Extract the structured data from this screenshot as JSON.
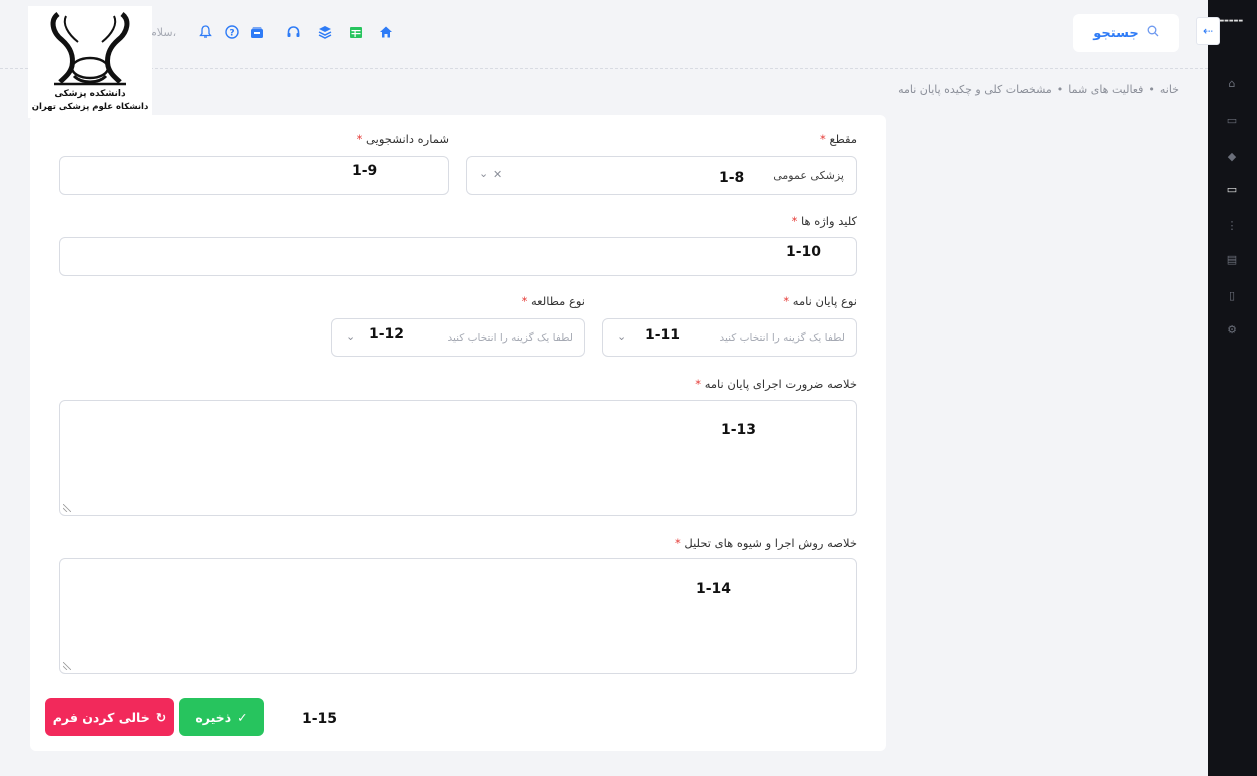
{
  "header": {
    "search_label": "جستجو",
    "greeting": "سلام،",
    "icons": [
      "bell-icon",
      "help-icon",
      "inbox-icon",
      "support-icon",
      "layers-icon",
      "table-icon",
      "home-icon"
    ]
  },
  "logo": {
    "line1": "دانشکده پزشکی",
    "line2": "دانشکاه علوم پزشکی تهران"
  },
  "breadcrumb": [
    "خانه",
    "فعالیت های شما",
    "مشخصات کلی و چکیده پایان نامه"
  ],
  "form": {
    "maqta": {
      "label": "مقطع",
      "value": "پزشکی عمومی",
      "annotation": "1-8"
    },
    "student_number": {
      "label": "شماره دانشجویی",
      "annotation": "1-9"
    },
    "keywords": {
      "label": "کلید واژه ها",
      "annotation": "1-10"
    },
    "thesis_type": {
      "label": "نوع پایان نامه",
      "placeholder": "لطفا یک گزینه را انتخاب کنید",
      "annotation": "1-11"
    },
    "study_type": {
      "label": "نوع مطالعه",
      "placeholder": "لطفا یک گزینه را انتخاب کنید",
      "annotation": "1-12"
    },
    "necessity_summary": {
      "label": "خلاصه ضرورت اجرای پایان نامه",
      "annotation": "1-13"
    },
    "methods_summary": {
      "label": "خلاصه روش اجرا و شیوه های تحلیل",
      "annotation": "1-14"
    },
    "required_mark": "*",
    "buttons_annotation": "1-15"
  },
  "buttons": {
    "save": "ذخیره",
    "clear": "خالی کردن فرم"
  },
  "colors": {
    "primary": "#2e7bf6",
    "save": "#27c45e",
    "clear": "#f2295b",
    "required": "#e53935",
    "sidebar": "#111217"
  }
}
